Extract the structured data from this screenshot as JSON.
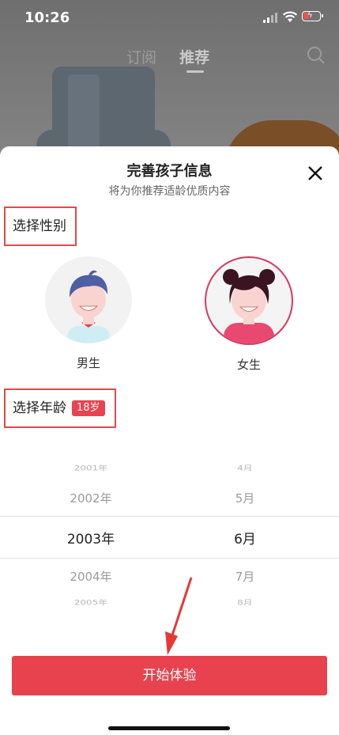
{
  "status_bar": {
    "time": "10:26"
  },
  "top_tabs": [
    {
      "label": "订阅",
      "active": false
    },
    {
      "label": "推荐",
      "active": true
    }
  ],
  "sheet": {
    "title": "完善孩子信息",
    "subtitle": "将为你推荐适龄优质内容",
    "gender_section_label": "选择性别",
    "genders": [
      {
        "label": "男生",
        "selected": false
      },
      {
        "label": "女生",
        "selected": true
      }
    ],
    "age_section_label": "选择年龄",
    "age_badge": "18岁",
    "year_options": [
      "2001年",
      "2002年",
      "2003年",
      "2004年",
      "2005年"
    ],
    "month_options": [
      "4月",
      "5月",
      "6月",
      "7月",
      "8月"
    ],
    "selected_year": "2003年",
    "selected_month": "6月",
    "start_button": "开始体验"
  },
  "colors": {
    "accent": "#e8424f",
    "female_ring": "#d43a62",
    "annotation_border": "#e04a4a"
  },
  "icons": [
    "search-icon",
    "close-icon",
    "signal-icon",
    "wifi-icon",
    "battery-icon",
    "annotation-arrow"
  ]
}
